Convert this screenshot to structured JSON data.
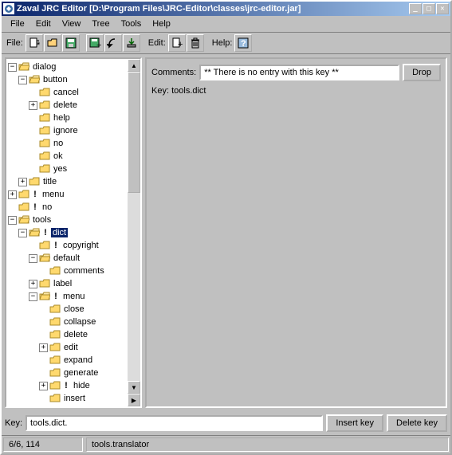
{
  "title": "Zaval JRC Editor  [D:\\Program Files\\JRC-Editor\\classes\\jrc-editor.jar]",
  "menus": {
    "file": "File",
    "edit": "Edit",
    "view": "View",
    "tree": "Tree",
    "tools": "Tools",
    "help": "Help"
  },
  "toolbar": {
    "file_label": "File:",
    "edit_label": "Edit:",
    "help_label": "Help:"
  },
  "tree": {
    "dialog": "dialog",
    "button": "button",
    "cancel": "cancel",
    "delete": "delete",
    "help": "help",
    "ignore": "ignore",
    "no": "no",
    "ok": "ok",
    "yes": "yes",
    "title": "title",
    "menu": "menu",
    "no2": "no",
    "tools": "tools",
    "dict": "dict",
    "copyright": "copyright",
    "default": "default",
    "comments": "comments",
    "label": "label",
    "menu2": "menu",
    "close": "close",
    "collapse": "collapse",
    "delete2": "delete",
    "edit": "edit",
    "expand": "expand",
    "generate": "generate",
    "hide": "hide",
    "insert": "insert"
  },
  "right": {
    "comments_label": "Comments:",
    "comments_value": "** There is no entry with this key **",
    "drop": "Drop",
    "key_label": "Key: ",
    "key_value": "tools.dict"
  },
  "bottom": {
    "key_label": "Key:",
    "key_value": "tools.dict.",
    "insert": "Insert key",
    "delete": "Delete key"
  },
  "status": {
    "left": "6/6, 114",
    "right": "tools.translator"
  }
}
